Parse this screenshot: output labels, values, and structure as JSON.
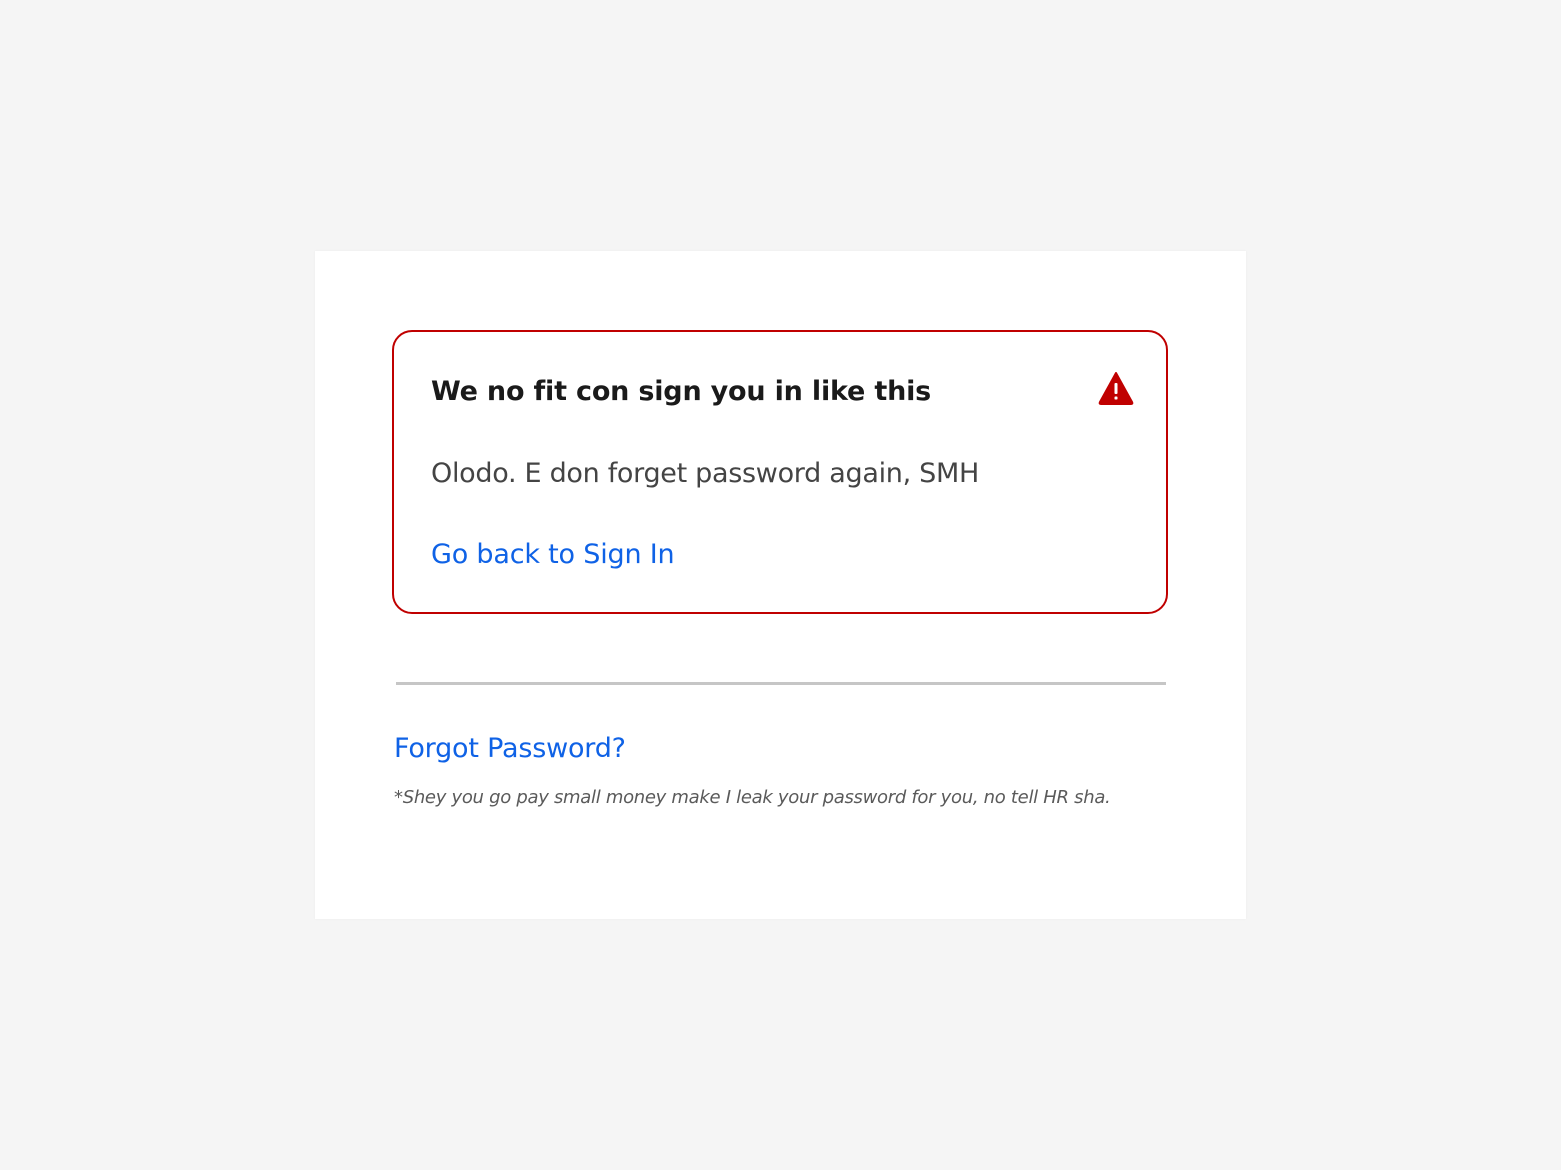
{
  "error_alert": {
    "title": "We no fit con sign you in like this",
    "message": "Olodo. E don forget password again, SMH",
    "link_label": "Go back to Sign In",
    "icon": "warning-triangle-icon",
    "border_color": "#c00000",
    "icon_color": "#c00000"
  },
  "recovery": {
    "forgot_label": "Forgot Password?",
    "footnote": "*Shey you go pay small money make I leak your password for you, no tell HR sha."
  },
  "colors": {
    "background": "#f5f5f5",
    "card": "#ffffff",
    "link": "#0f62e6",
    "divider": "#c6c6c6"
  }
}
